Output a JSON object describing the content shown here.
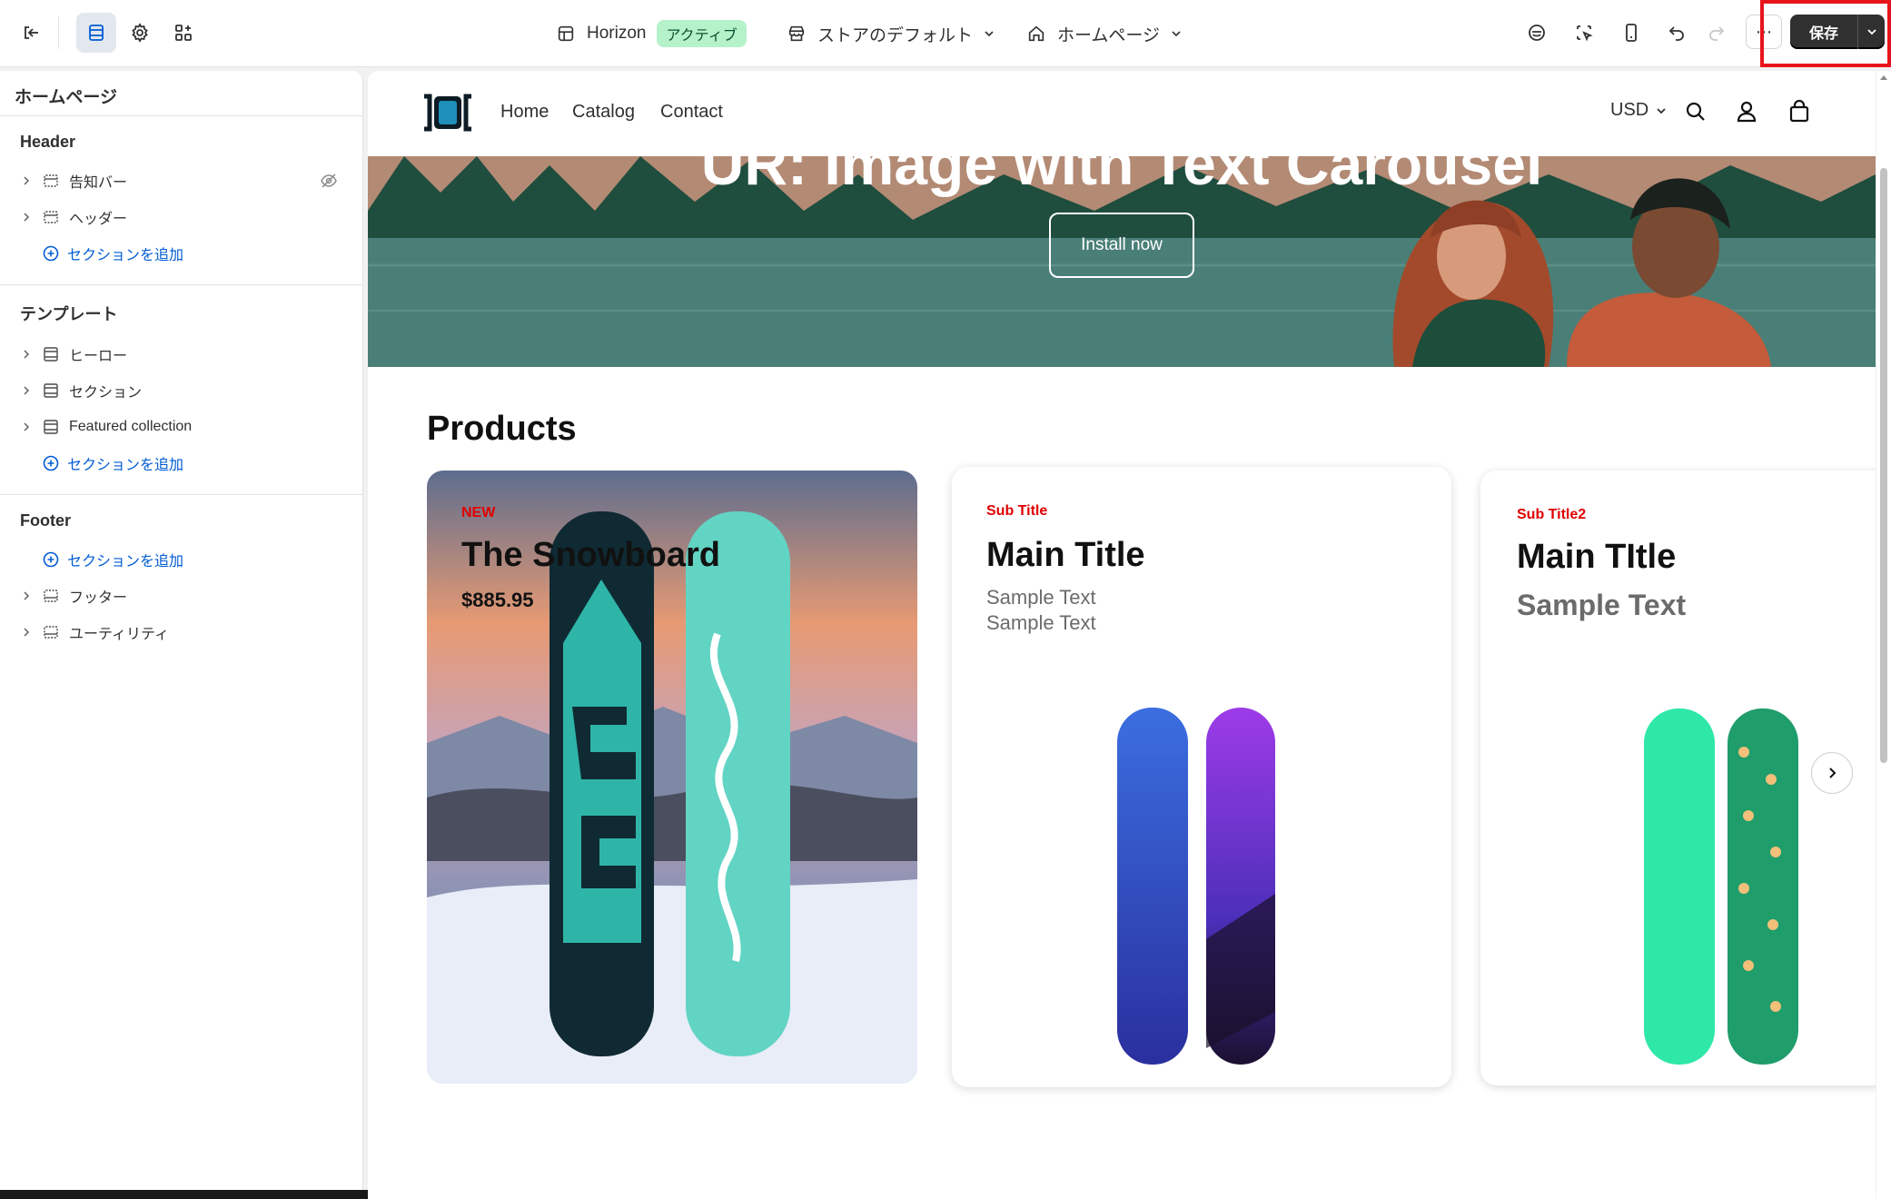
{
  "topbar": {
    "theme_name": "Horizon",
    "theme_status": "アクティブ",
    "store_context": "ストアのデフォルト",
    "page_select": "ホームページ",
    "save_label": "保存",
    "more_label": "⋯"
  },
  "sidebar": {
    "title": "ホームページ",
    "groups": [
      {
        "title": "Header",
        "items": [
          {
            "label": "告知バー"
          },
          {
            "label": "ヘッダー"
          }
        ],
        "add_label": "セクションを追加"
      },
      {
        "title": "テンプレート",
        "items": [
          {
            "label": "ヒーロー"
          },
          {
            "label": "セクション"
          },
          {
            "label": "Featured collection"
          }
        ],
        "add_label": "セクションを追加"
      },
      {
        "title": "Footer",
        "add_label": "セクションを追加",
        "items": [
          {
            "label": "フッター"
          },
          {
            "label": "ユーティリティ"
          }
        ]
      }
    ]
  },
  "preview": {
    "nav": [
      "Home",
      "Catalog",
      "Contact"
    ],
    "currency": "USD",
    "hero": {
      "title": "UR: Image with Text Carousel",
      "button": "Install now"
    },
    "products_title": "Products",
    "cards": [
      {
        "sub": "NEW",
        "title": "The Snowboard",
        "price": "$885.95"
      },
      {
        "sub": "Sub Title",
        "title": "Main Title",
        "text1": "Sample Text",
        "text2": "Sample Text"
      },
      {
        "sub": "Sub Title2",
        "title": "Main TItle",
        "text1": "Sample Text"
      }
    ]
  },
  "colors": {
    "accent_blue": "#005bd3",
    "active_badge": "#b5f2c9",
    "highlight_red": "#e8141b",
    "sub_title_red": "#e00000"
  }
}
